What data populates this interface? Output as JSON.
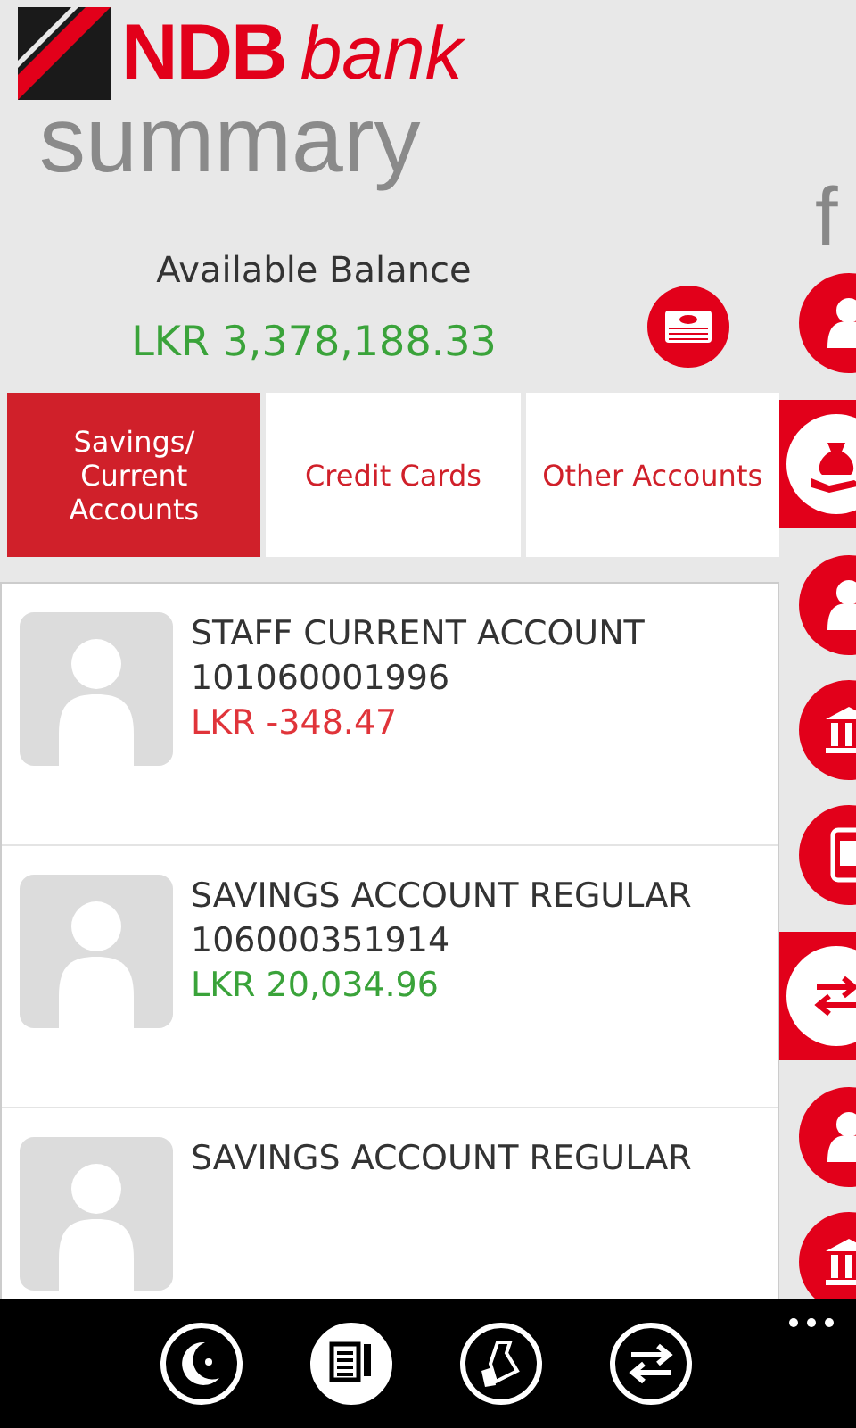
{
  "header": {
    "brand": "NDB",
    "brand_suffix": "bank",
    "title": "summary"
  },
  "balance": {
    "label": "Available Balance",
    "amount": "LKR 3,378,188.33"
  },
  "tabs": [
    {
      "label": "Savings/ Current Accounts",
      "selected": true
    },
    {
      "label": "Credit Cards",
      "selected": false
    },
    {
      "label": "Other Accounts",
      "selected": false
    }
  ],
  "accounts": [
    {
      "name": "STAFF CURRENT ACCOUNT",
      "number": "101060001996",
      "amount": "LKR -348.47",
      "negative": true
    },
    {
      "name": "SAVINGS ACCOUNT REGULAR",
      "number": "106000351914",
      "amount": "LKR 20,034.96",
      "negative": false
    },
    {
      "name": "SAVINGS ACCOUNT REGULAR"
    }
  ],
  "side_menu": {
    "heading": "f",
    "items": [
      {
        "kind": "person",
        "selected": false
      },
      {
        "kind": "money",
        "selected": true
      },
      {
        "kind": "person",
        "selected": false
      },
      {
        "kind": "bank",
        "selected": false
      },
      {
        "kind": "phone",
        "selected": false
      },
      {
        "kind": "transfer",
        "selected": true
      },
      {
        "kind": "person",
        "selected": false
      },
      {
        "kind": "bank",
        "selected": false
      }
    ]
  },
  "app_bar": {
    "buttons": [
      {
        "kind": "moon",
        "selected": false
      },
      {
        "kind": "notes",
        "selected": true
      },
      {
        "kind": "bag",
        "selected": false
      },
      {
        "kind": "transfer",
        "selected": false
      }
    ]
  }
}
